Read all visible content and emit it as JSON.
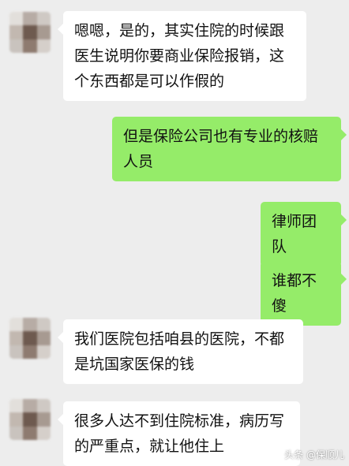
{
  "chat": {
    "messages": [
      {
        "sender": "other",
        "text": "嗯嗯，是的，其实住院的时候跟医生说明你要商业保险报销，这个东西都是可以作假的"
      },
      {
        "sender": "me",
        "text": "但是保险公司也有专业的核赔人员"
      },
      {
        "sender": "me",
        "text": "律师团队"
      },
      {
        "sender": "me",
        "text": "谁都不傻"
      },
      {
        "sender": "other",
        "text": "我们医院包括咱县的医院，不都是坑国家医保的钱"
      },
      {
        "sender": "other",
        "text": "很多人达不到住院标准，病历写的严重点，就让他住上"
      }
    ]
  },
  "watermark": "头条 @保顺儿",
  "colors": {
    "background": "#ededed",
    "incoming_bubble": "#ffffff",
    "outgoing_bubble": "#95ec69",
    "text": "#111111"
  },
  "icons": {
    "avatar": "blurred-avatar"
  }
}
